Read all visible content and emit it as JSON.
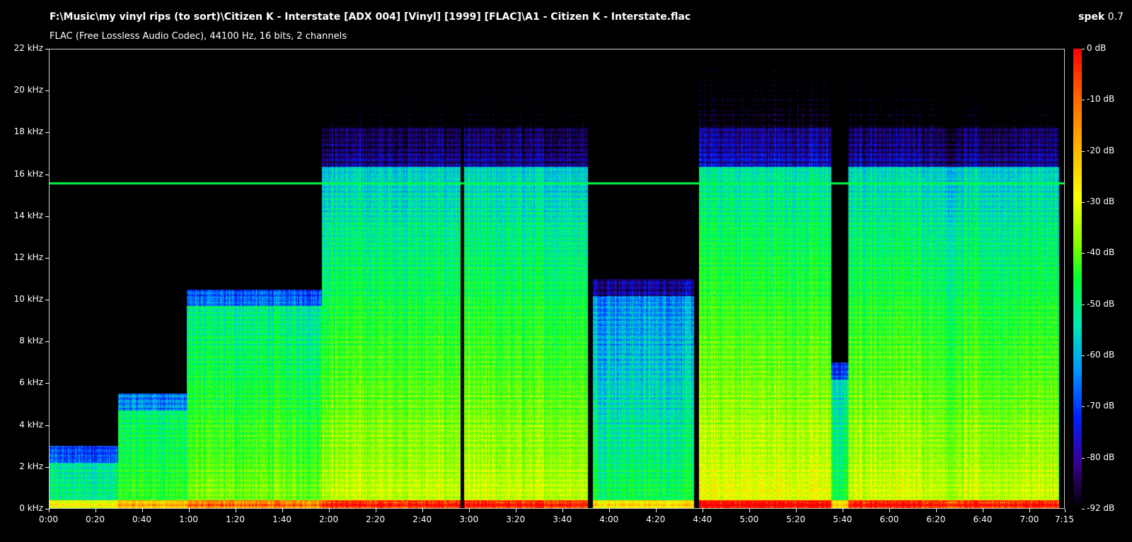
{
  "header": {
    "file_path": "F:\\Music\\my vinyl rips (to sort)\\Citizen K - Interstate [ADX 004] [Vinyl] [1999] [FLAC]\\A1 - Citizen K - Interstate.flac",
    "format_info": "FLAC (Free Lossless Audio Codec), 44100 Hz, 16 bits, 2 channels",
    "app_name": "spek",
    "app_version": "0.7"
  },
  "y_axis": {
    "ticks": [
      "0 kHz",
      "2 kHz",
      "4 kHz",
      "6 kHz",
      "8 kHz",
      "10 kHz",
      "12 kHz",
      "14 kHz",
      "16 kHz",
      "18 kHz",
      "20 kHz",
      "22 kHz"
    ]
  },
  "x_axis": {
    "ticks": [
      "0:00",
      "0:20",
      "0:40",
      "1:00",
      "1:20",
      "1:40",
      "2:00",
      "2:20",
      "2:40",
      "3:00",
      "3:20",
      "3:40",
      "4:00",
      "4:20",
      "4:40",
      "5:00",
      "5:20",
      "5:40",
      "6:00",
      "6:20",
      "6:40",
      "7:00",
      "7:15"
    ]
  },
  "scale": {
    "labels": [
      "0 dB",
      "-10 dB",
      "-20 dB",
      "-30 dB",
      "-40 dB",
      "-50 dB",
      "-60 dB",
      "-70 dB",
      "-80 dB",
      "-92 dB"
    ]
  },
  "colors": {
    "background": "#000000",
    "text": "#ffffff"
  }
}
